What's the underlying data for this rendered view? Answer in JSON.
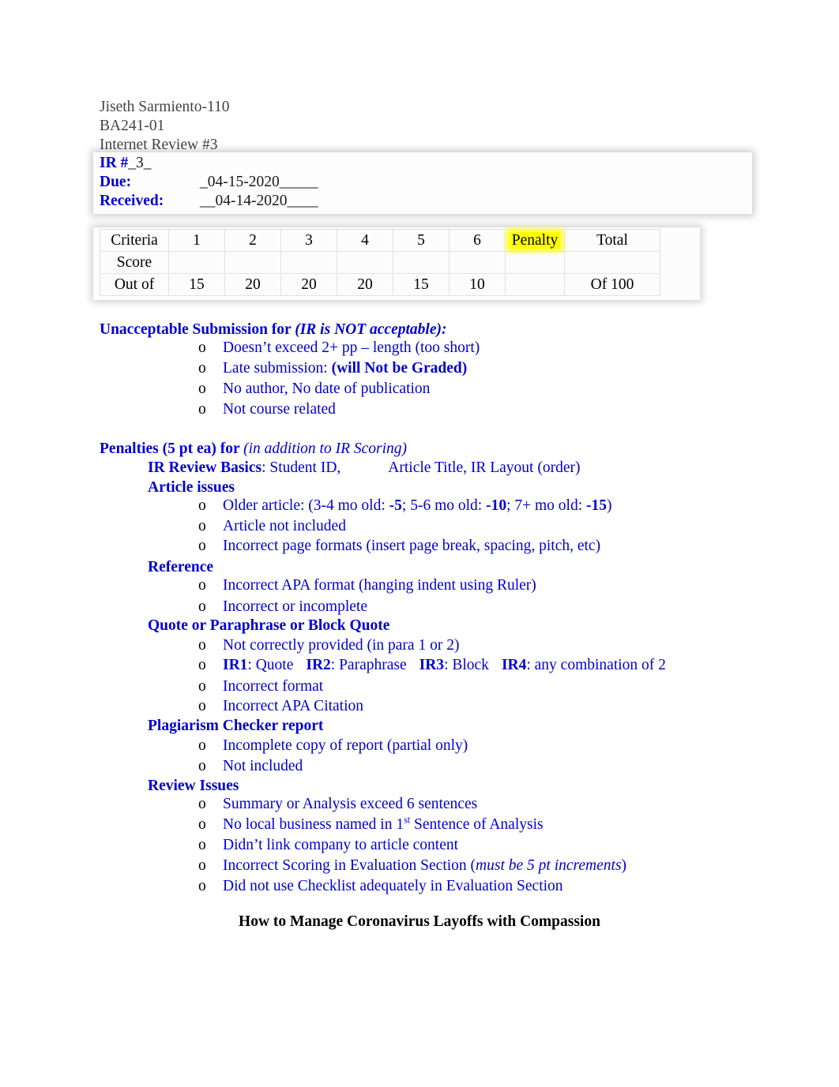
{
  "header": {
    "student": "Jiseth Sarmiento-110",
    "course": "BA241-01",
    "assignment": "Internet Review #3"
  },
  "ir_box": {
    "ir_label": "IR #",
    "ir_value": "_3_",
    "due_label": "Due:",
    "due_value": "_04-15-2020_____",
    "received_label": "Received:",
    "received_value": "__04-14-2020____"
  },
  "criteria_table": {
    "row_labels": [
      "Criteria",
      "Score",
      "Out of"
    ],
    "headers": [
      "1",
      "2",
      "3",
      "4",
      "5",
      "6",
      "Penalty",
      "Total"
    ],
    "penalty_header": "Penalty",
    "total_header": "Total",
    "score_row": [
      "",
      "",
      "",
      "",
      "",
      "",
      "",
      ""
    ],
    "out_of_row": [
      "15",
      "20",
      "20",
      "20",
      "15",
      "10",
      "",
      "Of  100"
    ],
    "highlight_color": "#FFFF00"
  },
  "unacceptable": {
    "heading_bold": "Unacceptable Submission for ",
    "heading_italic": "(IR is NOT acceptable):",
    "items": [
      "Doesn’t exceed 2+ pp – length (too short)",
      "Late submission: (will Not be Graded)",
      "No author, No date of publication",
      "Not course related"
    ],
    "item2_plain": "Late submission: ",
    "item2_bold": "(will Not be Graded)"
  },
  "penalties": {
    "heading_bold": "Penalties (5 pt ea) for ",
    "heading_italic": "(in addition to IR Scoring)",
    "ir_review_basics_bold": "IR Review Basics",
    "ir_review_basics_rest1": ": Student ID,",
    "ir_review_basics_rest2": "Article Title,  IR Layout (order)",
    "sub_article_issues": "Article issues",
    "older_article_pre": "Older article: (3-4 mo old: ",
    "older_article_v1": "-5",
    "older_article_mid1": ";  5-6 mo old: ",
    "older_article_v2": "-10",
    "older_article_mid2": "; 7+ mo old: ",
    "older_article_v3": "-15",
    "older_article_end": ")",
    "article_items": [
      "Article not included",
      "Incorrect page formats (insert page break, spacing, pitch, etc)"
    ],
    "sub_reference": "Reference",
    "reference_items": [
      "Incorrect APA format (hanging indent using Ruler)",
      "Incorrect or incomplete"
    ],
    "sub_quote": "Quote or Paraphrase or Block Quote",
    "quote_item1": "Not correctly provided (in para 1 or 2)",
    "quote_ir1_bold": "IR1",
    "quote_ir1_rest": ": Quote",
    "quote_ir2_bold": "IR2",
    "quote_ir2_rest": ": Paraphrase",
    "quote_ir3_bold": "IR3",
    "quote_ir3_rest": ": Block",
    "quote_ir4_bold": "IR4",
    "quote_ir4_rest": ": any combination of 2",
    "quote_items_rest": [
      "Incorrect format",
      "Incorrect APA Citation"
    ],
    "sub_plagiarism": "Plagiarism Checker report",
    "plagiarism_items": [
      "Incomplete copy of report (partial only)",
      "Not included"
    ],
    "sub_review_issues": "Review Issues",
    "review_item1": "Summary or Analysis exceed 6 sentences",
    "review_item2_pre": "No local business named in 1",
    "review_item2_sup": "st",
    "review_item2_post": " Sentence of Analysis",
    "review_item3": "Didn’t link company to article content",
    "review_item4_pre": "Incorrect Scoring in Evaluation Section (",
    "review_item4_ital": "must be 5 pt increments",
    "review_item4_post": ")",
    "review_item5": "Did not use Checklist adequately in Evaluation Section"
  },
  "article_title": "How to Manage Coronavirus Layoffs with Compassion",
  "bullet_marker": "o",
  "colors": {
    "blue_text": "#0000D4",
    "header_gray": "#434343",
    "highlight_yellow": "#FFFF00"
  }
}
